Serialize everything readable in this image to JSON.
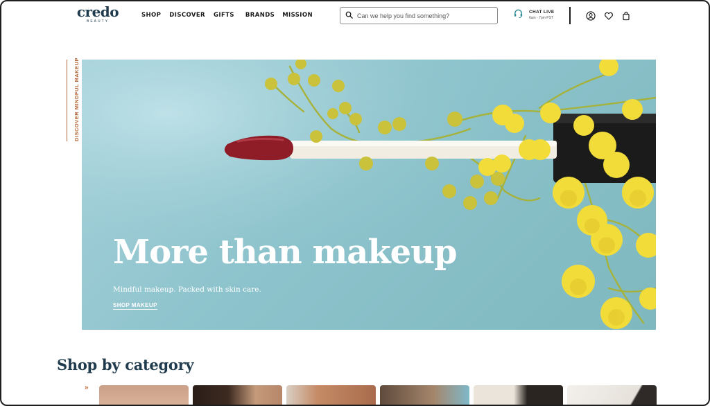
{
  "brand": {
    "name": "credo",
    "tagline": "BEAUTY"
  },
  "nav": {
    "items": [
      "SHOP",
      "DISCOVER",
      "GIFTS",
      "BRANDS",
      "MISSION"
    ]
  },
  "search": {
    "placeholder": "Can we help you find something?"
  },
  "chat": {
    "label": "CHAT LIVE",
    "hours": "6am - 7pm PST"
  },
  "header_icons": [
    "account-icon",
    "heart-icon",
    "bag-icon"
  ],
  "hero": {
    "side_label": "DISCOVER MINDFUL MAKEUP",
    "title": "More than makeup",
    "subtitle": "Mindful makeup. Packed with skin care.",
    "cta": "SHOP MAKEUP",
    "colors": {
      "background": "#8dc3cc",
      "text": "#ffffff",
      "lipstick": "#8e1d28",
      "flower": "#f2dc3a"
    }
  },
  "category": {
    "heading": "Shop by category",
    "arrow": "»",
    "tiles": [
      {
        "name": "category-tile-1",
        "color": "#d8a88c"
      },
      {
        "name": "category-tile-2",
        "color": "#3a2a22"
      },
      {
        "name": "category-tile-3",
        "color": "#c98a66"
      },
      {
        "name": "category-tile-4",
        "color": "#a9896f"
      },
      {
        "name": "category-tile-5",
        "color": "#2c2824"
      },
      {
        "name": "category-tile-6",
        "color": "#e8e4df"
      }
    ]
  },
  "colors": {
    "brand": "#1f3b4d",
    "accent": "#b5673a"
  }
}
